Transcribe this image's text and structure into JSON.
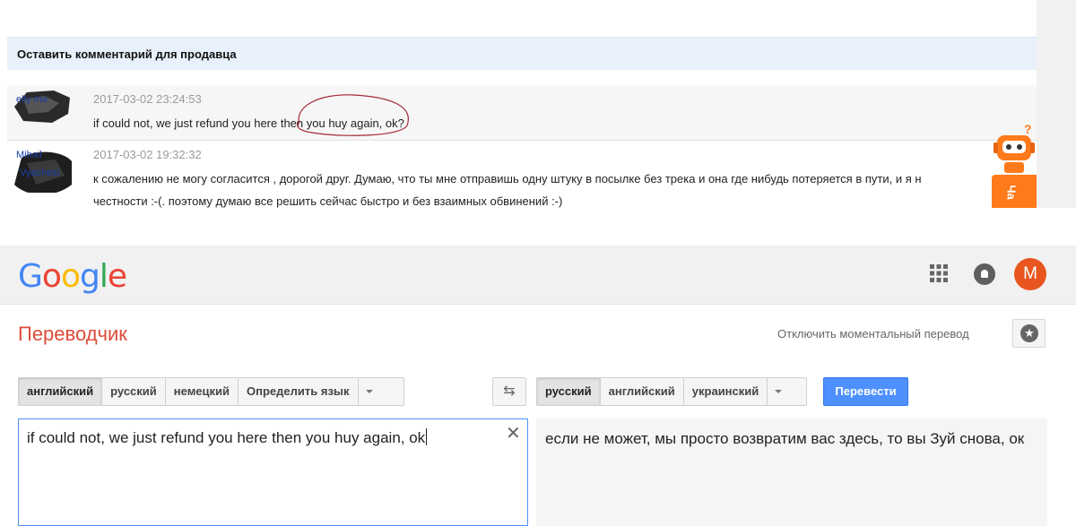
{
  "seller_comments": {
    "header": "Оставить комментарий для продавца",
    "comments": [
      {
        "user": "elly ma",
        "date": "2017-03-02 23:24:53",
        "text": "if could not, we just refund you here then you huy again, ok?"
      },
      {
        "user": "Mihail",
        "user_extra": "Vyachesl",
        "date": "2017-03-02 19:32:32",
        "text_line1": "к сожалению не могу согласится , дорогой друг. Думаю, что ты мне отправишь одну штуку в посылке без трека и она где нибудь потеряется в пути, и я н",
        "text_line2": "честности :-(. поэтому думаю все решить сейчас быстро и без взаимных обвинений :-)"
      }
    ],
    "chat_tab_label": "Ча",
    "robot_badge": "?"
  },
  "google_bar": {
    "logo": [
      "G",
      "o",
      "o",
      "g",
      "l",
      "e"
    ],
    "avatar_letter": "M"
  },
  "translator": {
    "title": "Переводчик",
    "instant_toggle": "Отключить моментальный перевод",
    "source_langs": [
      "английский",
      "русский",
      "немецкий",
      "Определить язык"
    ],
    "target_langs": [
      "русский",
      "английский",
      "украинский"
    ],
    "translate_button": "Перевести",
    "source_text": "if could not, we just refund you here then you huy again, ok",
    "translation": "если не может, мы просто возвратим вас здесь, то вы Зуй снова, ок"
  },
  "colors": {
    "accent_blue": "#4d90fe",
    "title_red": "#dd4b39",
    "avatar_orange": "#e8551f",
    "scribble": "#a52a3a"
  }
}
